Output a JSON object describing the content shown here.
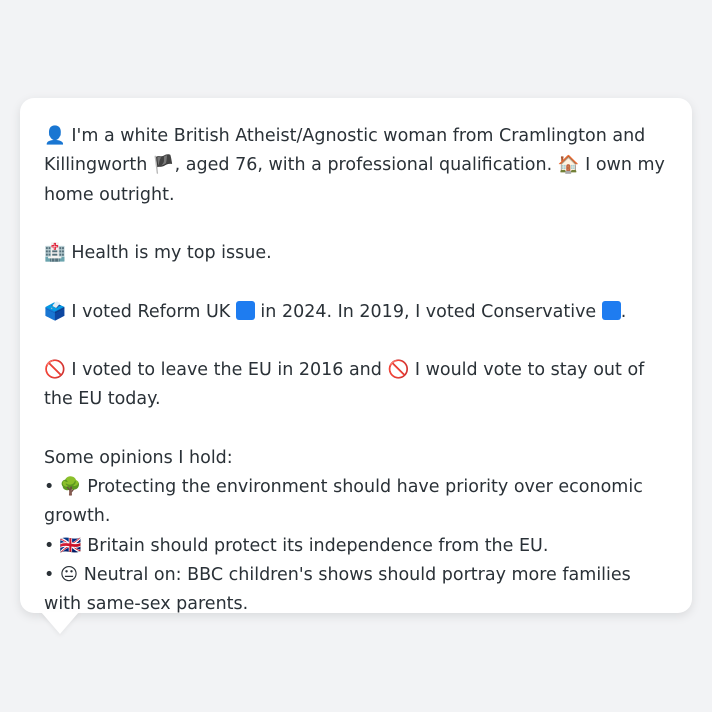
{
  "colors": {
    "background": "#f2f3f5",
    "card": "#ffffff",
    "text": "#2a3137",
    "party_square": "#1e7cf0"
  },
  "profile": {
    "icon_person": "👤",
    "intro": "I'm a white British Atheist/Agnostic woman from Cramlington and Killingworth",
    "icon_flag_england": "🏴",
    "intro_rest": ", aged 76, with a professional qualification.",
    "icon_house": "🏠",
    "home": "I own my home outright."
  },
  "health": {
    "icon": "🏥",
    "text": "Health is my top issue."
  },
  "vote": {
    "icon": "🗳️",
    "text_a": "I voted Reform UK",
    "text_b": "in 2024. In 2019, I voted Conservative",
    "text_c": "."
  },
  "eu": {
    "icon1": "🚫",
    "text_a": "I voted to leave the EU in 2016 and",
    "icon2": "🚫",
    "text_b": "I would vote to stay out of the EU today."
  },
  "opinions": {
    "heading": "Some opinions I hold:",
    "bullet": "•",
    "items": [
      {
        "icon": "🌳",
        "text": "Protecting the environment should have priority over economic growth."
      },
      {
        "icon": "🇬🇧",
        "text": "Britain should protect its independence from the EU."
      },
      {
        "icon": "😐",
        "text": "Neutral on: BBC children's shows should portray more families with same-sex parents."
      }
    ]
  }
}
